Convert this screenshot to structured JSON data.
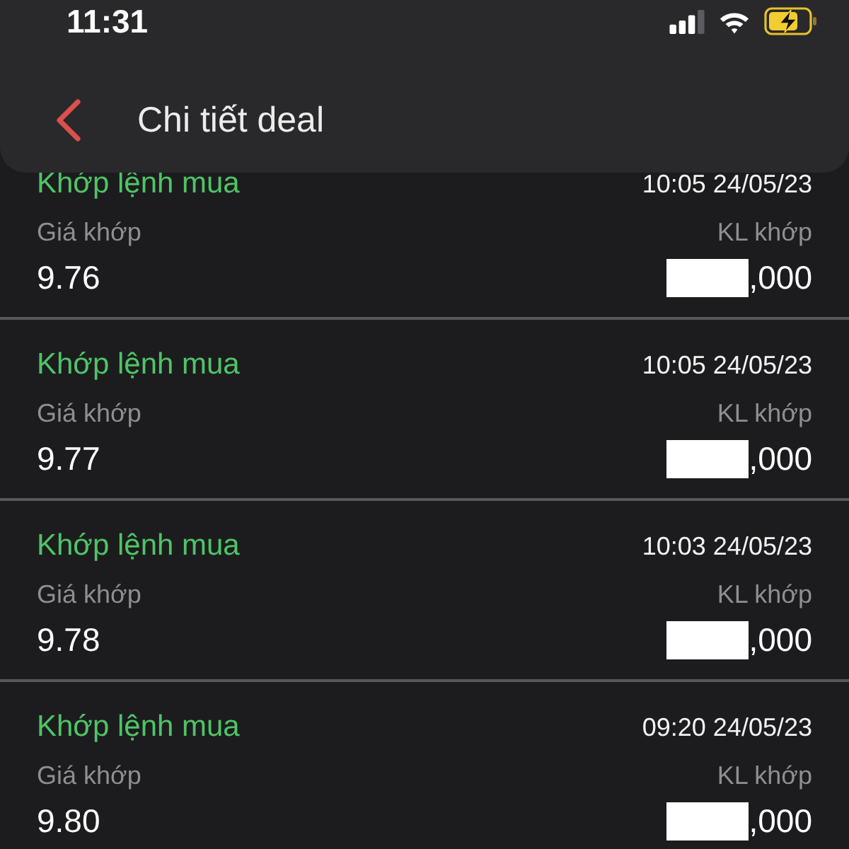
{
  "status_bar": {
    "time": "11:31"
  },
  "header": {
    "title": "Chi tiết deal"
  },
  "deals": [
    {
      "type": "Khớp lệnh mua",
      "timestamp": "10:05 24/05/23",
      "price_label": "Giá khớp",
      "price": "9.76",
      "quantity_label": "KL khớp",
      "quantity": ",000",
      "redacted": true
    },
    {
      "type": "Khớp lệnh mua",
      "timestamp": "10:05 24/05/23",
      "price_label": "Giá khớp",
      "price": "9.77",
      "quantity_label": "KL khớp",
      "quantity": ",000",
      "redacted": true
    },
    {
      "type": "Khớp lệnh mua",
      "timestamp": "10:03 24/05/23",
      "price_label": "Giá khớp",
      "price": "9.78",
      "quantity_label": "KL khớp",
      "quantity": ",000",
      "redacted": true
    },
    {
      "type": "Khớp lệnh mua",
      "timestamp": "09:20 24/05/23",
      "price_label": "Giá khớp",
      "price": "9.80",
      "quantity_label": "KL khớp",
      "quantity": ",000",
      "redacted": true
    }
  ]
}
